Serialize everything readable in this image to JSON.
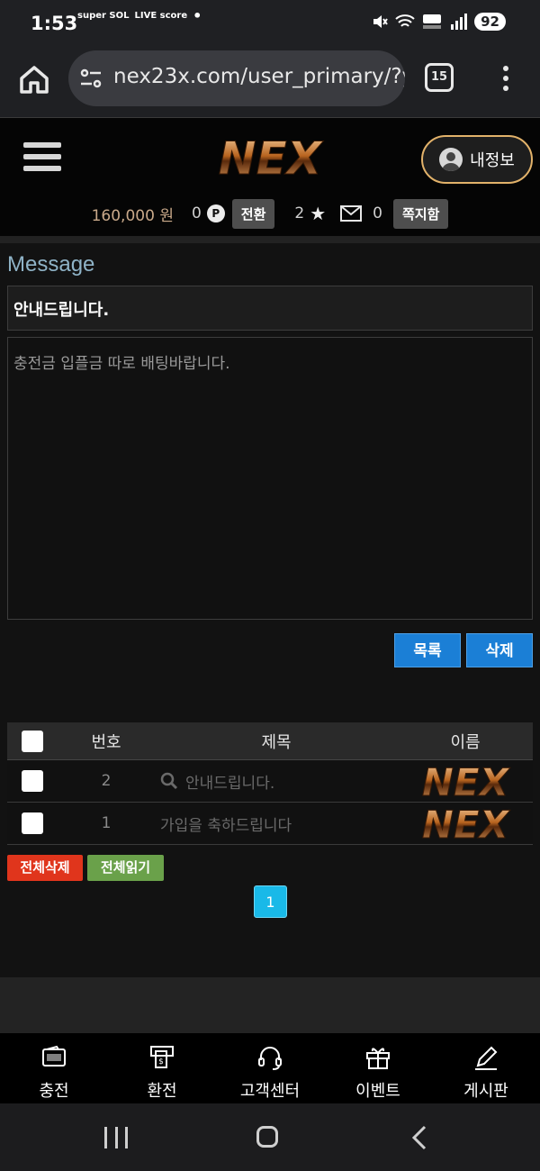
{
  "status_bar": {
    "time": "1:53",
    "app_icons": [
      "super SOL",
      "LIVE score"
    ],
    "battery": "92"
  },
  "browser": {
    "url": "nex23x.com/user_primary/?y",
    "tab_count": "15"
  },
  "header": {
    "logo_text": "NEX",
    "my_info_label": "내정보",
    "balance": "160,000 원",
    "points": "0",
    "points_icon": "P",
    "convert_button": "전환",
    "star_count": "2",
    "message_count": "0",
    "message_box_button": "쪽지함"
  },
  "message": {
    "section_title": "Message",
    "subject": "안내드립니다.",
    "body": "충전금 입플금 따로 배팅바랍니다.",
    "list_button": "목록",
    "delete_button": "삭제"
  },
  "table": {
    "headers": {
      "number": "번호",
      "title": "제목",
      "name": "이름"
    },
    "rows": [
      {
        "number": "2",
        "title": "안내드립니다.",
        "name_logo": "NEX"
      },
      {
        "number": "1",
        "title": "가입을 축하드립니다",
        "name_logo": "NEX"
      }
    ]
  },
  "actions": {
    "delete_all": "전체삭제",
    "read_all": "전체읽기",
    "current_page": "1"
  },
  "bottom_nav": [
    {
      "label": "충전",
      "icon": "wallet-icon"
    },
    {
      "label": "환전",
      "icon": "atm-icon"
    },
    {
      "label": "고객센터",
      "icon": "headset-icon"
    },
    {
      "label": "이벤트",
      "icon": "gift-icon"
    },
    {
      "label": "게시판",
      "icon": "pencil-icon"
    }
  ],
  "colors": {
    "accent_blue": "#1b7fd6",
    "delete_red": "#e0351c",
    "read_green": "#6aa14a",
    "page_cyan": "#19b9e8",
    "gold": "#e2b26a"
  }
}
